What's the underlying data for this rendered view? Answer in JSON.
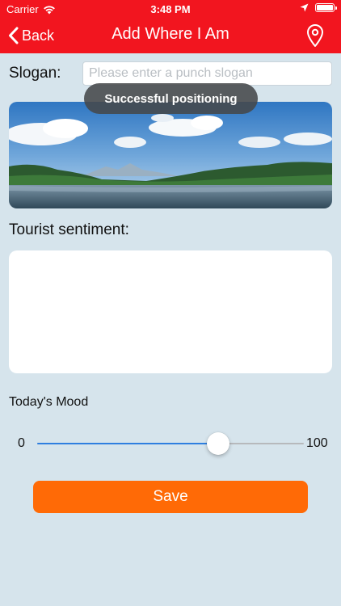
{
  "status_bar": {
    "carrier": "Carrier",
    "time": "3:48 PM",
    "icons": [
      "wifi-icon",
      "location-arrow-icon",
      "battery-icon"
    ]
  },
  "nav": {
    "back_label": "Back",
    "title": "Add Where I Am",
    "right_icon": "location-pin-icon",
    "bar_color": "#f2151f"
  },
  "form": {
    "slogan_label": "Slogan:",
    "slogan_placeholder": "Please enter a punch slogan",
    "slogan_value": "",
    "image_alt": "lake landscape",
    "sentiment_label": "Tourist sentiment:",
    "sentiment_value": "",
    "mood_label": "Today's Mood",
    "mood_min": "0",
    "mood_max": "100",
    "mood_value": 68,
    "save_label": "Save",
    "save_color": "#ff6a06"
  },
  "toast": {
    "message": "Successful positioning"
  }
}
